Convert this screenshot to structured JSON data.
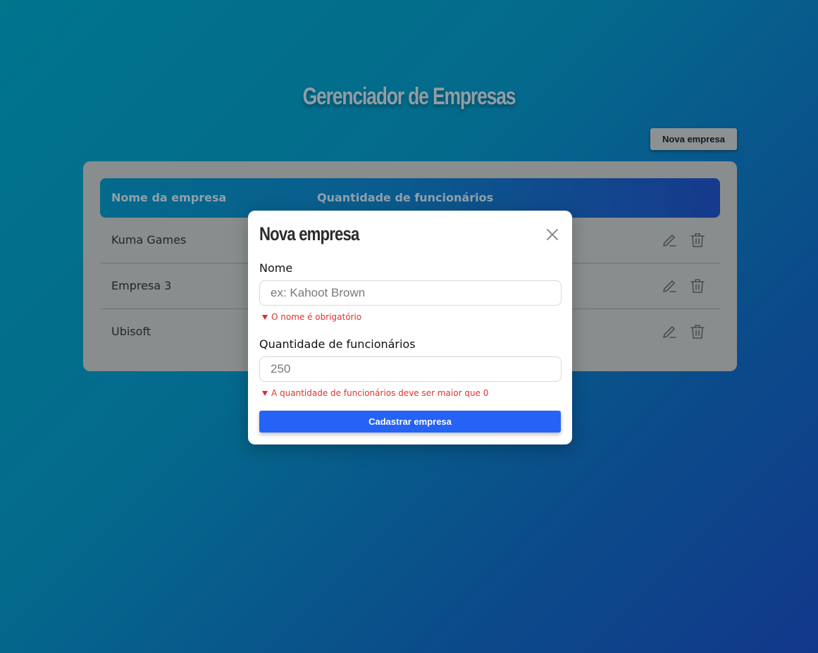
{
  "header": {
    "title": "Gerenciador de Empresas",
    "new_button_label": "Nova empresa"
  },
  "table": {
    "columns": [
      "Nome da empresa",
      "Quantidade de funcionários"
    ],
    "rows": [
      {
        "name": "Kuma Games"
      },
      {
        "name": "Empresa 3"
      },
      {
        "name": "Ubisoft"
      }
    ],
    "row_actions": [
      "edit-icon",
      "trash-icon"
    ]
  },
  "modal": {
    "title": "Nova empresa",
    "close_icon": "close-icon",
    "fields": {
      "name": {
        "label": "Nome",
        "placeholder": "ex: Kahoot Brown",
        "value": "",
        "error": "O nome é obrigatório"
      },
      "employees": {
        "label": "Quantidade de funcionários",
        "placeholder": "250",
        "value": "",
        "error": "A quantidade de funcionários deve ser maior que 0"
      }
    },
    "submit_label": "Cadastrar empresa"
  },
  "colors": {
    "accent": "#2463f5",
    "error": "#e0322e",
    "background_start": "#00758c",
    "background_end": "#12388a"
  }
}
